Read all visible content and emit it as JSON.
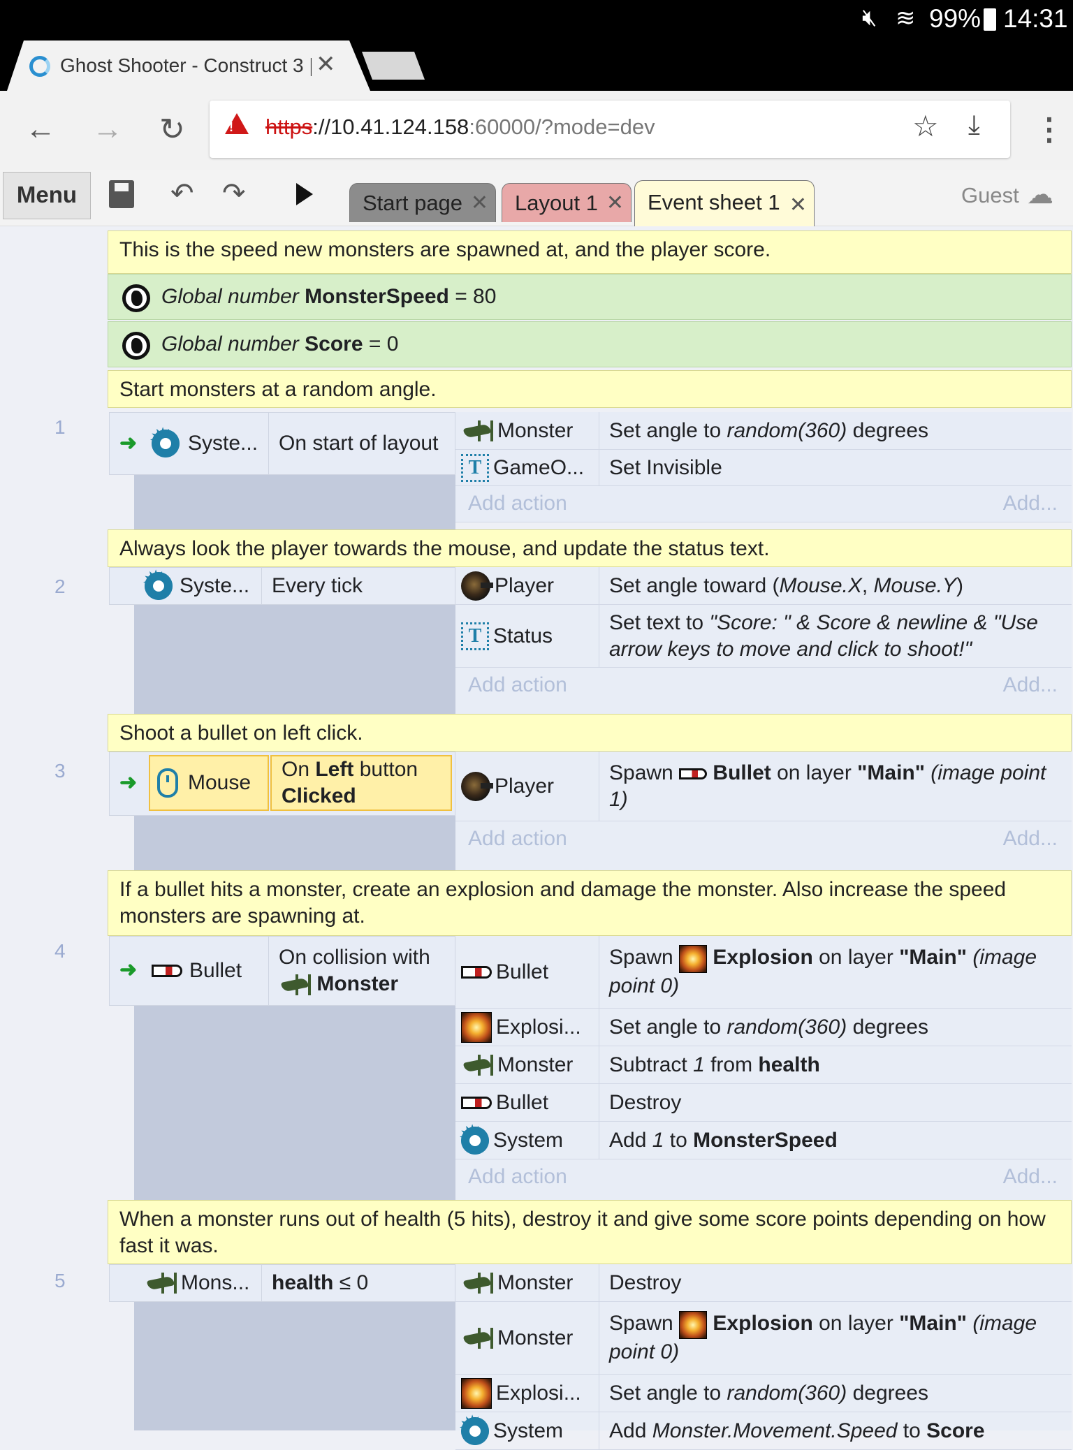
{
  "status_bar": {
    "battery": "99%",
    "time": "14:31"
  },
  "browser": {
    "tab_title": "Ghost Shooter - Construct 3 |",
    "url_https": "https",
    "url_host": "://10.41.124.158",
    "url_rest": ":60000/?mode=dev"
  },
  "app": {
    "menu_label": "Menu",
    "tabs": [
      {
        "label": "Start page"
      },
      {
        "label": "Layout 1"
      },
      {
        "label": "Event sheet 1"
      }
    ],
    "user_label": "Guest"
  },
  "sheet": {
    "comment0": "This is the speed new monsters are spawned at, and the player score.",
    "globals": [
      {
        "prefix": "Global number",
        "name": "MonsterSpeed",
        "value": "= 80"
      },
      {
        "prefix": "Global number",
        "name": "Score",
        "value": "= 0"
      }
    ],
    "add_action": "Add action",
    "add_short": "Add...",
    "events": [
      {
        "number": "1",
        "comment": "Start monsters at a random angle.",
        "cond_object": "Syste...",
        "cond_text": "On start of layout",
        "actions": [
          {
            "object": "Monster",
            "a": "Set angle to ",
            "b": "random(360)",
            "c": " degrees"
          },
          {
            "object": "GameO...",
            "a": "Set Invisible"
          }
        ]
      },
      {
        "number": "2",
        "comment": "Always look the player towards the mouse, and update the status text.",
        "cond_object": "Syste...",
        "cond_text": "Every tick",
        "actions": [
          {
            "object": "Player",
            "a": "Set angle toward (",
            "b": "Mouse.X",
            "c": ", ",
            "d": "Mouse.Y",
            "e": ")"
          },
          {
            "object": "Status",
            "a": "Set text to ",
            "b": "\"Score: \" & Score & newline & \"Use arrow keys to move and click to shoot!\""
          }
        ]
      },
      {
        "number": "3",
        "comment": "Shoot a bullet on left click.",
        "cond_object": "Mouse",
        "cond_a": "On ",
        "cond_b": "Left",
        "cond_c": " button",
        "cond_d": "Clicked",
        "actions": [
          {
            "object": "Player",
            "a": "Spawn ",
            "b": "Bullet",
            "c": " on layer ",
            "d": "\"Main\"",
            "e": " (image point 1)"
          }
        ]
      },
      {
        "number": "4",
        "comment": "If a bullet hits a monster, create an explosion and damage the monster.  Also increase the speed monsters are spawning at.",
        "cond_object": "Bullet",
        "cond_a": "On collision with",
        "cond_b": "Monster",
        "actions": [
          {
            "object": "Bullet",
            "a": "Spawn ",
            "b": "Explosion",
            "c": " on layer ",
            "d": "\"Main\"",
            "e": " (image point 0)"
          },
          {
            "object": "Explosi...",
            "a": "Set angle to ",
            "b": "random(360)",
            "c": " degrees"
          },
          {
            "object": "Monster",
            "a": "Subtract ",
            "b": "1",
            "c": " from ",
            "d": "health"
          },
          {
            "object": "Bullet",
            "a": "Destroy"
          },
          {
            "object": "System",
            "a": "Add ",
            "b": "1",
            "c": " to ",
            "d": "MonsterSpeed"
          }
        ]
      },
      {
        "number": "5",
        "comment": "When a monster runs out of health (5 hits), destroy it and give some score points depending on how fast it was.",
        "cond_object": "Mons...",
        "cond_a": "health",
        "cond_b": " ≤ 0",
        "actions": [
          {
            "object": "Monster",
            "a": "Destroy"
          },
          {
            "object": "Monster",
            "a": "Spawn ",
            "b": "Explosion",
            "c": " on layer ",
            "d": "\"Main\"",
            "e": " (image point 0)"
          },
          {
            "object": "Explosi...",
            "a": "Set angle to ",
            "b": "random(360)",
            "c": " degrees"
          },
          {
            "object": "System",
            "a": "Add ",
            "b": "Monster.Movement.Speed",
            "c": " to ",
            "d": "Score"
          }
        ]
      }
    ]
  }
}
